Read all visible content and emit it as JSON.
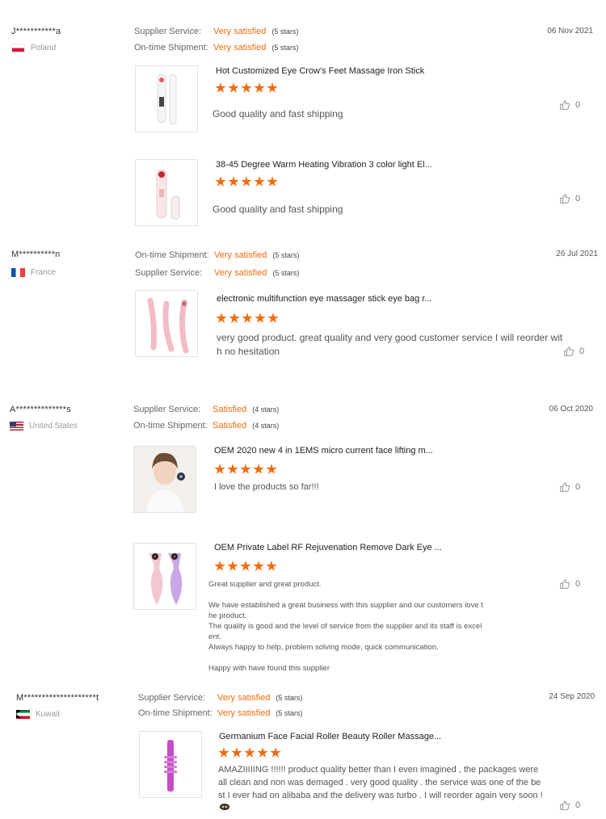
{
  "reviews": [
    {
      "user": "J***********a",
      "country": "Poland",
      "date": "06 Nov 2021",
      "ratings": [
        {
          "label": "Supplier Service:",
          "value": "Very satisfied",
          "stars": "(5 stars)"
        },
        {
          "label": "On-time Shipment:",
          "value": "Very satisfied",
          "stars": "(5 stars)"
        }
      ],
      "items": [
        {
          "title": "Hot Customized Eye Crow's Feet Massage Iron Stick",
          "comment": "Good quality and fast shipping",
          "likes": "0"
        },
        {
          "title": "38-45 Degree Warm Heating Vibration 3 color light El...",
          "comment": "Good quality and fast shipping",
          "likes": "0"
        }
      ]
    },
    {
      "user": "M**********n",
      "country": "France",
      "date": "26 Jul 2021",
      "ratings": [
        {
          "label": "On-time Shipment:",
          "value": "Very satisfied",
          "stars": "(5 stars)"
        },
        {
          "label": "Supplier Service:",
          "value": "Very satisfied",
          "stars": "(5 stars)"
        }
      ],
      "items": [
        {
          "title": "electronic multifunction eye massager stick eye bag r...",
          "comment_lines": [
            "very good product. great quality and very good customer service I will reorder wit",
            "h no hesitation"
          ],
          "likes": "0"
        }
      ]
    },
    {
      "user": "A**************s",
      "country": "United States",
      "date": "06 Oct 2020",
      "ratings": [
        {
          "label": "Supplier Service:",
          "value": "Satisfied",
          "stars": "(4 stars)"
        },
        {
          "label": "On-time Shipment:",
          "value": "Satisfied",
          "stars": "(4 stars)"
        }
      ],
      "items": [
        {
          "title": "OEM 2020 new 4 in 1EMS micro current face lifting m...",
          "comment": "I love the products so far!!!",
          "likes": "0"
        },
        {
          "title": "OEM Private Label RF Rejuvenation Remove Dark Eye ...",
          "comment_lines": [
            "Great supplier and great product.",
            "",
            "We have established a great business with this supplier and our customers love t",
            "he product.",
            "The quality is good and the level of service from the supplier and its staff is excel",
            "ent.",
            "Always happy to help, problem solving mode, quick communication.",
            "",
            "Happy with have found this supplier"
          ],
          "likes": "0"
        }
      ]
    },
    {
      "user": "M********************t",
      "country": "Kuwait",
      "date": "24 Sep 2020",
      "ratings": [
        {
          "label": "Supplier Service:",
          "value": "Very satisfied",
          "stars": "(5 stars)"
        },
        {
          "label": "On-time Shipment:",
          "value": "Very satisfied",
          "stars": "(5 stars)"
        }
      ],
      "items": [
        {
          "title": "Germanium Face Facial Roller Beauty Roller Massage...",
          "comment_lines": [
            "AMAZIIIIING !!!!!! product quality better than I even imagined , the packages were",
            "all clean and non was demaged . very good quality . the service was one of the be",
            "st I ever had on alibaba and the delivery was turbo . I will reorder again very soon !"
          ],
          "likes": "0"
        }
      ]
    }
  ],
  "colors": {
    "accent": "#f26b0c",
    "muted": "#666666"
  },
  "icons": {
    "like": "thumbs-up-icon"
  }
}
